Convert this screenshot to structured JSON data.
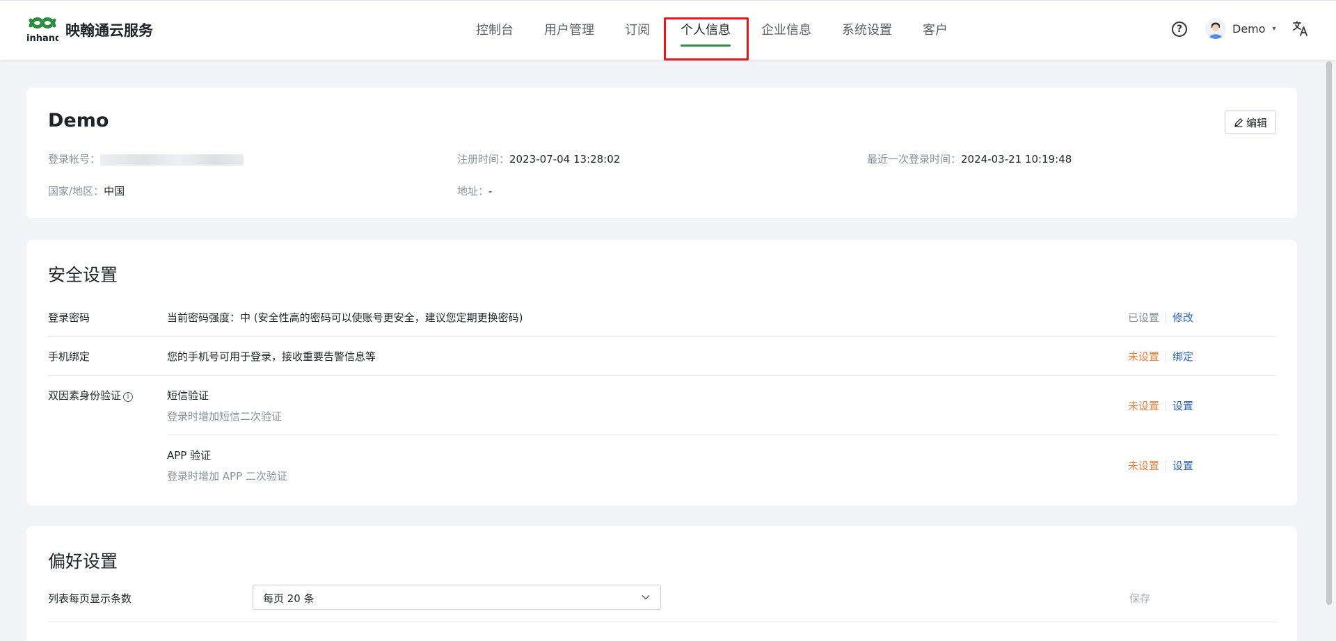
{
  "header": {
    "brand": "映翰通云服务",
    "logo_icon": "inhand-logo-icon",
    "nav": [
      {
        "label": "控制台"
      },
      {
        "label": "用户管理"
      },
      {
        "label": "订阅"
      },
      {
        "label": "个人信息",
        "active": true
      },
      {
        "label": "企业信息"
      },
      {
        "label": "系统设置"
      },
      {
        "label": "客户"
      }
    ],
    "help_icon": "?",
    "user_name": "Demo",
    "caret": "▾",
    "accent_color": "#2c8f3f",
    "highlight_color": "#e3161b"
  },
  "profile": {
    "name": "Demo",
    "edit_label": "编辑",
    "account_label": "登录帐号：",
    "register_label": "注册时间：",
    "register_value": "2023-07-04 13:28:02",
    "last_login_label": "最近一次登录时间：",
    "last_login_value": "2024-03-21 10:19:48",
    "country_label": "国家/地区：",
    "country_value": "中国",
    "address_label": "地址：",
    "address_value": "-"
  },
  "security": {
    "title": "安全设置",
    "password": {
      "label": "登录密码",
      "desc": "当前密码强度：中 (安全性高的密码可以使账号更安全，建议您定期更换密码)",
      "status": "已设置",
      "action": "修改"
    },
    "phone": {
      "label": "手机绑定",
      "desc": "您的手机号可用于登录，接收重要告警信息等",
      "status": "未设置",
      "action": "绑定"
    },
    "twofa": {
      "label": "双因素身份验证",
      "info_icon": "i",
      "sms": {
        "title": "短信验证",
        "sub": "登录时增加短信二次验证",
        "status": "未设置",
        "action": "设置"
      },
      "app": {
        "title": "APP 验证",
        "sub": "登录时增加 APP 二次验证",
        "status": "未设置",
        "action": "设置"
      }
    },
    "status_unset_color": "#f0803c",
    "link_color": "#2b61c4"
  },
  "preferences": {
    "title": "偏好设置",
    "page_size_label": "列表每页显示条数",
    "page_size_value": "每页 20 条",
    "save_label": "保存"
  }
}
